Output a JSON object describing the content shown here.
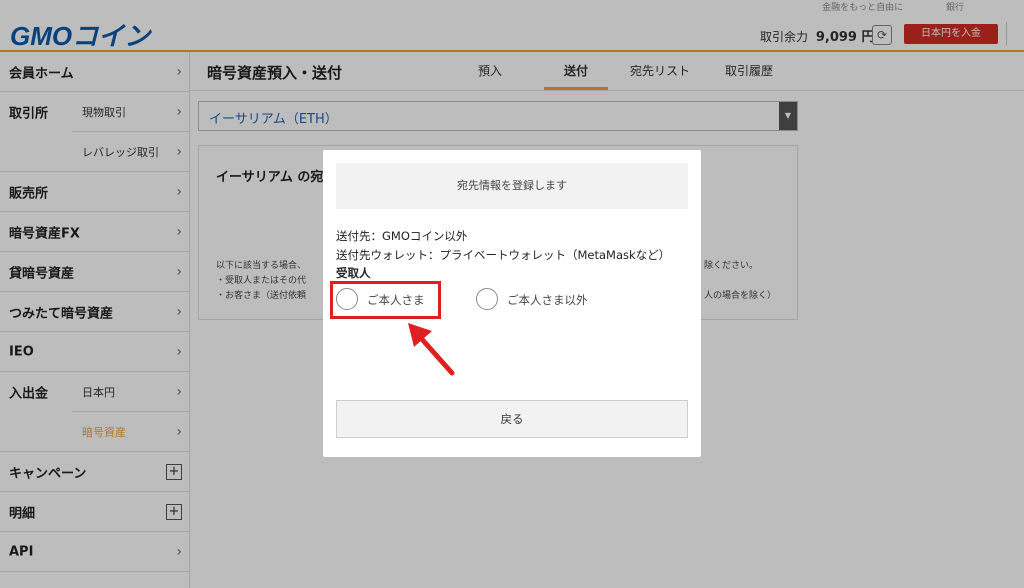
{
  "header": {
    "logo_gmo": "GMO",
    "logo_coin": "コイン",
    "top_links": [
      "金融をもっと自由に",
      "銀行"
    ],
    "balance_label": "取引余力",
    "balance_value": "9,099 円",
    "refresh_icon": "refresh-icon",
    "deposit_button": "日本円を入金"
  },
  "sidebar": {
    "items": [
      {
        "label": "会員ホーム"
      },
      {
        "label": "取引所",
        "subs": [
          "現物取引",
          "レバレッジ取引"
        ]
      },
      {
        "label": "販売所"
      },
      {
        "label": "暗号資産FX"
      },
      {
        "label": "貸暗号資産"
      },
      {
        "label": "つみたて暗号資産"
      },
      {
        "label": "IEO"
      },
      {
        "label": "入出金",
        "subs": [
          "日本円",
          "暗号資産"
        ]
      },
      {
        "label": "キャンペーン"
      },
      {
        "label": "明細"
      },
      {
        "label": "API"
      }
    ]
  },
  "main": {
    "title": "暗号資産預入・送付",
    "tabs": [
      {
        "label": "預入"
      },
      {
        "label": "送付",
        "active": true
      },
      {
        "label": "宛先リスト"
      },
      {
        "label": "取引履歴"
      }
    ],
    "currency": "イーサリアム（ETH）",
    "panel_title": "イーサリアム の宛",
    "panel_notes": [
      "以下に該当する場合、",
      "・受取人またはその代",
      "・お客さま（送付依頼",
      "除ください。",
      "人の場合を除く）"
    ]
  },
  "modal": {
    "header": "宛先情報を登録します",
    "destination": "送付先：GMOコイン以外",
    "wallet": "送付先ウォレット：プライベートウォレット（MetaMaskなど）",
    "recipient_label": "受取人",
    "options": [
      "ご本人さま",
      "ご本人さま以外"
    ],
    "back_button": "戻る"
  },
  "colors": {
    "brand_blue": "#0a5aa8",
    "accent_orange": "#e8a23a",
    "deposit_red": "#d12c22",
    "highlight_red": "#e02020"
  }
}
